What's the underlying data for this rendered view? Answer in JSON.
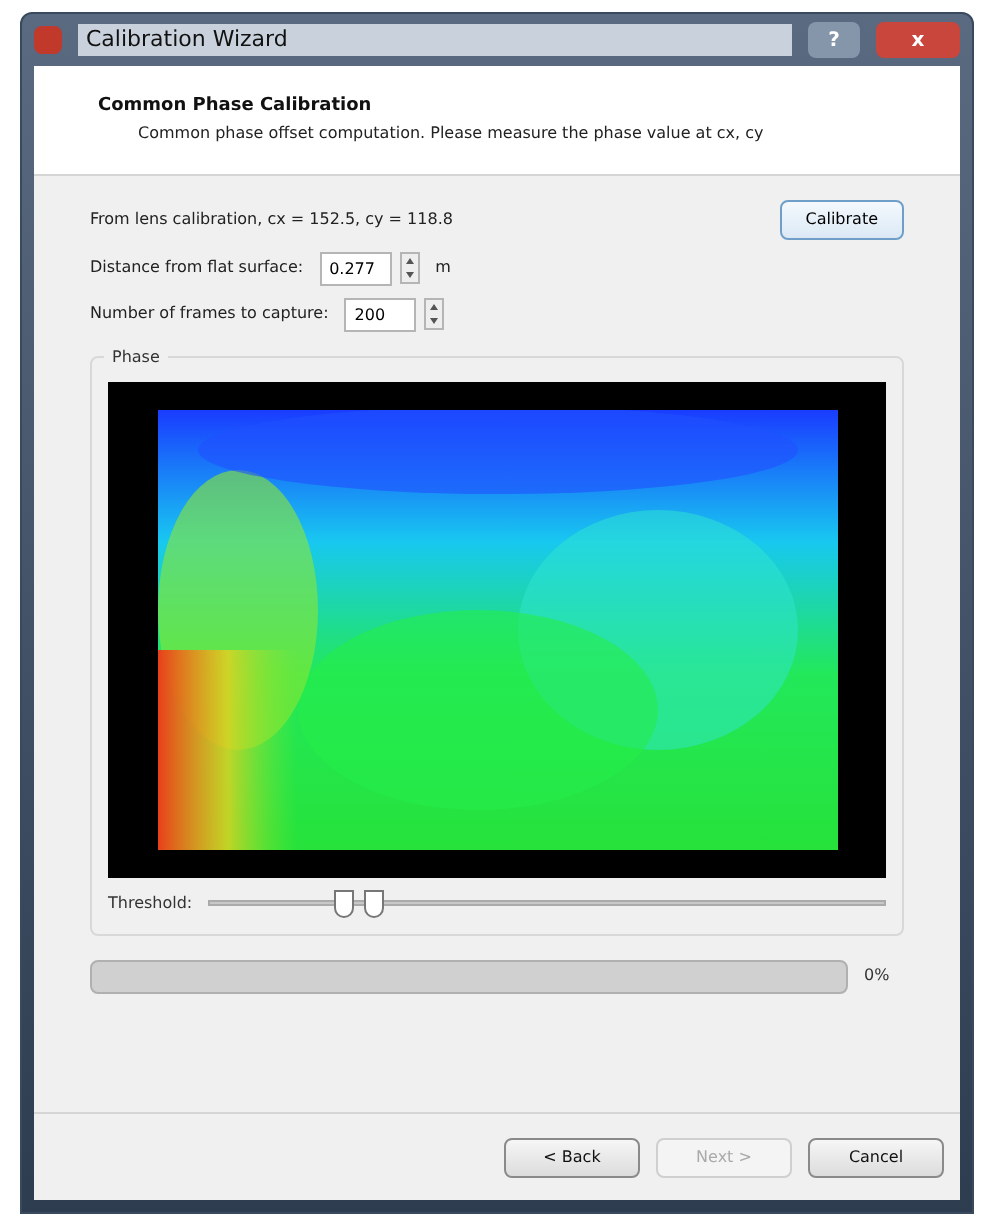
{
  "window": {
    "title": "Calibration Wizard",
    "buttons": [
      "?",
      "x"
    ]
  },
  "header": {
    "title": "Common Phase Calibration",
    "subtitle": "Common phase offset computation. Please measure the phase value at cx, cy"
  },
  "lens_info": "From lens calibration, cx = 152.5, cy = 118.8",
  "calibrate_button": "Calibrate",
  "fields": [
    {
      "label": "Distance from flat surface:",
      "value": "0.277",
      "unit": "m"
    },
    {
      "label": "Number of frames to capture:",
      "value": "200"
    }
  ],
  "phase_group": {
    "title": "Phase",
    "threshold": {
      "label": "Threshold:",
      "thumbs": [
        {
          "level": 0.2
        },
        {
          "level": 0.245
        }
      ]
    }
  },
  "progress": {
    "level": 0,
    "reading": "0%"
  },
  "buttons": [
    {
      "label": "< Back",
      "disabled": false
    },
    {
      "label": "Next >",
      "disabled": true
    },
    {
      "label": "Cancel",
      "disabled": false
    }
  ]
}
